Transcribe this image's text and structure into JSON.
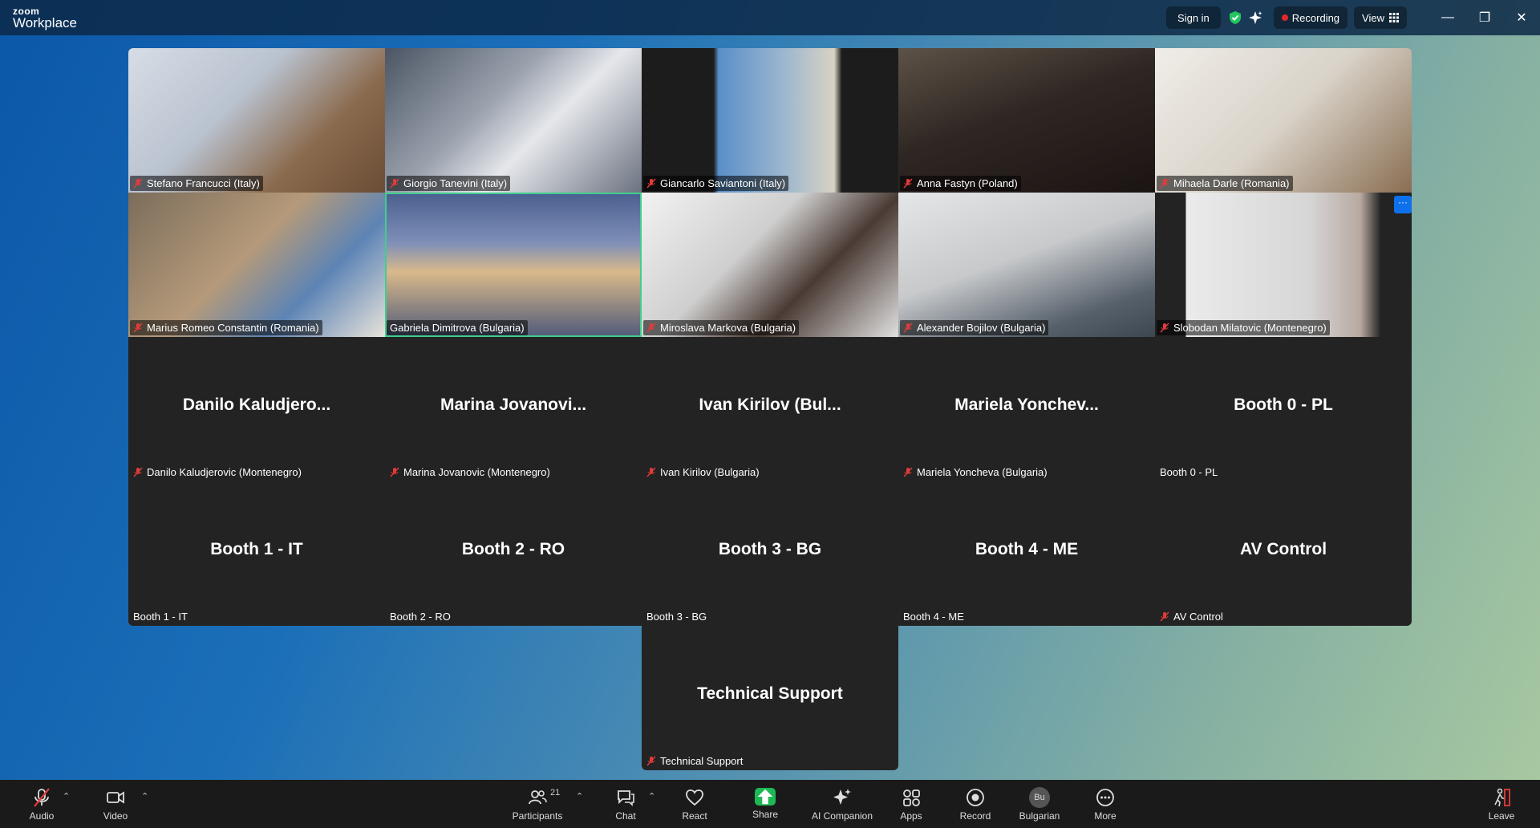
{
  "titlebar": {
    "brand_small": "zoom",
    "brand_main": "Workplace",
    "sign_in": "Sign in",
    "recording": "Recording",
    "view": "View"
  },
  "tiles": [
    {
      "label": "Stefano Francucci (Italy)",
      "muted": true
    },
    {
      "label": "Giorgio Tanevini (Italy)",
      "muted": true
    },
    {
      "label": "Giancarlo Saviantoni (Italy)",
      "muted": true
    },
    {
      "label": "Anna Fastyn (Poland)",
      "muted": true
    },
    {
      "label": "Mihaela Darle (Romania)",
      "muted": true
    },
    {
      "label": "Marius Romeo Constantin (Romania)",
      "muted": true
    },
    {
      "label": "Gabriela Dimitrova (Bulgaria)",
      "muted": false,
      "active": true
    },
    {
      "label": "Miroslava Markova (Bulgaria)",
      "muted": true
    },
    {
      "label": "Alexander Bojilov (Bulgaria)",
      "muted": true
    },
    {
      "label": "Slobodan Milatovic (Montenegro)",
      "muted": true
    },
    {
      "label": "Danilo Kaludjerovic (Montenegro)",
      "display": "Danilo  Kaludjero...",
      "muted": true
    },
    {
      "label": "Marina Jovanovic (Montenegro)",
      "display": "Marina  Jovanovi...",
      "muted": true
    },
    {
      "label": "Ivan Kirilov (Bulgaria)",
      "display": "Ivan  Kirilov  (Bul...",
      "muted": true
    },
    {
      "label": "Mariela Yoncheva (Bulgaria)",
      "display": "Mariela  Yonchev...",
      "muted": true
    },
    {
      "label": "Booth 0 - PL",
      "display": "Booth 0 - PL",
      "muted": false
    },
    {
      "label": "Booth 1 - IT",
      "display": "Booth 1 - IT",
      "muted": false
    },
    {
      "label": "Booth 2 - RO",
      "display": "Booth 2 - RO",
      "muted": false
    },
    {
      "label": "Booth 3 - BG",
      "display": "Booth 3 - BG",
      "muted": false
    },
    {
      "label": "Booth 4 - ME",
      "display": "Booth 4 - ME",
      "muted": false
    },
    {
      "label": "AV Control",
      "display": "AV Control",
      "muted": true
    }
  ],
  "tech_support": {
    "label": "Technical Support",
    "display": "Technical Support"
  },
  "toolbar": {
    "audio": "Audio",
    "video": "Video",
    "participants": "Participants",
    "participants_count": "21",
    "chat": "Chat",
    "react": "React",
    "share": "Share",
    "ai_companion": "AI Companion",
    "apps": "Apps",
    "record": "Record",
    "language": "Bulgarian",
    "language_abbr": "Bu",
    "more": "More",
    "leave": "Leave"
  }
}
